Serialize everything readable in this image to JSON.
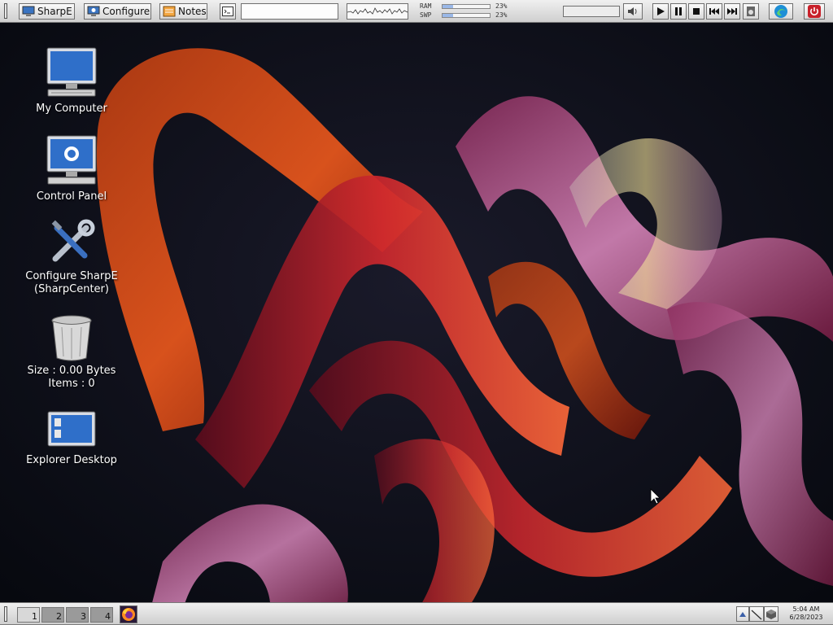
{
  "taskbar": {
    "sharpe_label": "SharpE",
    "configure_label": "Configure",
    "notes_label": "Notes",
    "ram_label": "RAM",
    "swp_label": "SWP",
    "ram_percent": "23%",
    "swp_percent": "23%",
    "ram_fraction": 0.23,
    "swp_fraction": 0.23
  },
  "desktop": {
    "icons": [
      {
        "label": "My Computer"
      },
      {
        "label": "Control Panel"
      },
      {
        "label": "Configure SharpE",
        "label2": "(SharpCenter)"
      },
      {
        "label": "Size : 0.00 Bytes",
        "label2": "Items : 0"
      },
      {
        "label": "Explorer Desktop"
      }
    ]
  },
  "bottom": {
    "workspaces": [
      "1",
      "2",
      "3",
      "4"
    ],
    "active_workspace": "1",
    "time": "5:04 AM",
    "date": "6/28/2023"
  },
  "colors": {
    "accent": "#e24d2a",
    "power": "#c8202a"
  }
}
